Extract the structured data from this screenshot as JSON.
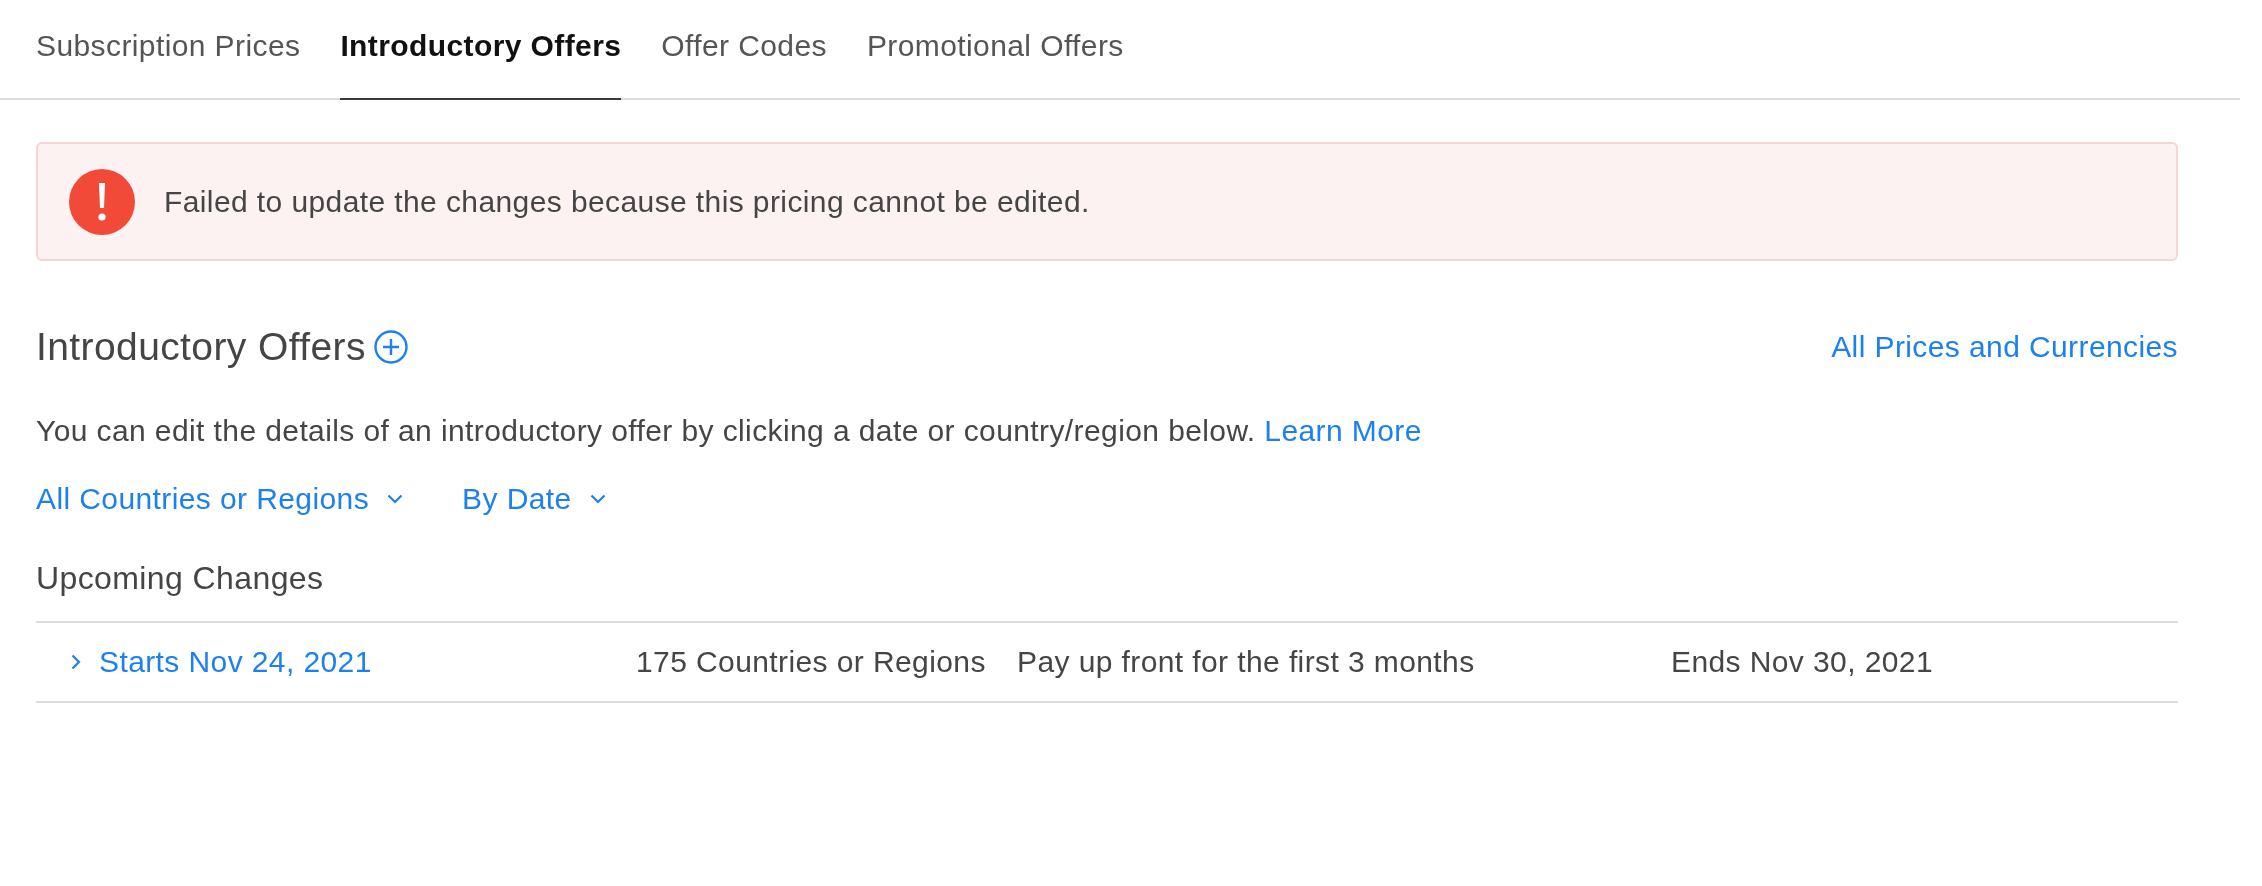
{
  "tabs": [
    {
      "label": "Subscription Prices",
      "selected": false
    },
    {
      "label": "Introductory Offers",
      "selected": true
    },
    {
      "label": "Offer Codes",
      "selected": false
    },
    {
      "label": "Promotional Offers",
      "selected": false
    }
  ],
  "alert": {
    "kind": "error",
    "message": "Failed to update the changes because this pricing cannot be edited."
  },
  "section": {
    "title": "Introductory Offers",
    "link": "All Prices and Currencies",
    "description": "You can edit the details of an introductory offer by clicking a date or country/region below.",
    "description_link": "Learn More"
  },
  "filters": [
    {
      "label": "All Countries or Regions"
    },
    {
      "label": "By Date"
    }
  ],
  "upcoming": {
    "title": "Upcoming Changes",
    "rows": [
      {
        "expanded": false,
        "start": "Starts Nov 24, 2021",
        "regions": "175 Countries or Regions",
        "offer": "Pay up front for the first 3 months",
        "end": "Ends Nov 30, 2021"
      }
    ]
  }
}
